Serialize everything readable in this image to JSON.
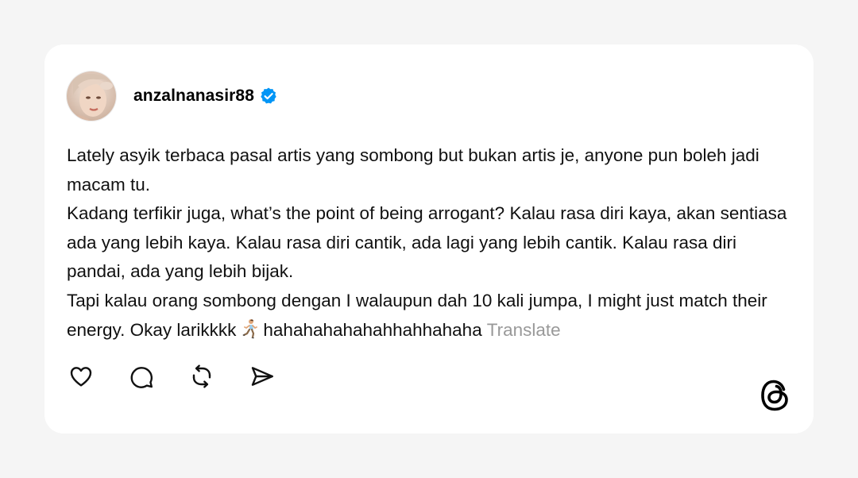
{
  "post": {
    "username": "anzalnanasir88",
    "verified": true,
    "paragraphs": [
      "Lately asyik terbaca pasal artis yang sombong but bukan artis je, anyone pun boleh jadi macam tu.",
      "Kadang terfikir juga, what’s the point of being arrogant? Kalau rasa diri kaya, akan sentiasa ada yang lebih kaya. Kalau rasa diri cantik, ada lagi yang lebih cantik. Kalau rasa diri pandai, ada yang lebih bijak."
    ],
    "last_paragraph_before_emoji": "Tapi kalau orang sombong dengan I walaupun dah 10 kali jumpa, I might just match their energy. Okay larikkkk",
    "last_paragraph_after_emoji": "hahahahahahahhahhahaha",
    "translate_label": "Translate"
  },
  "icons": {
    "like": "heart-icon",
    "comment": "comment-icon",
    "repost": "repost-icon",
    "share": "send-icon",
    "brand": "threads-logo-icon",
    "verified": "verified-badge-icon",
    "emoji": "running-woman-emoji"
  },
  "colors": {
    "background": "#f5f5f5",
    "card": "#ffffff",
    "text": "#111111",
    "muted": "#999999",
    "verified_blue": "#0095f6"
  }
}
